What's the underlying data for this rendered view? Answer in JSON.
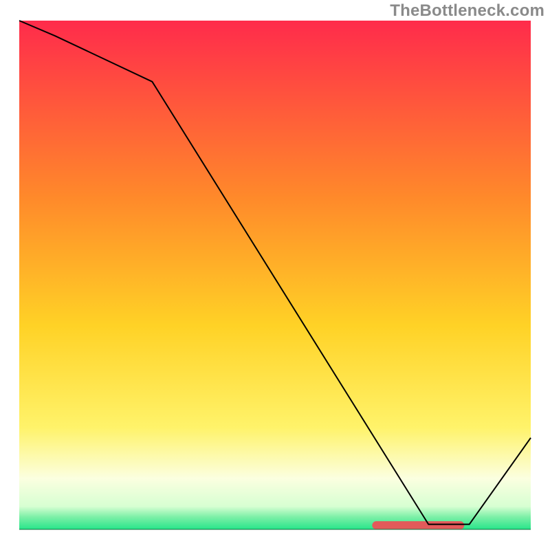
{
  "watermark": "TheBottleneck.com",
  "chart_data": {
    "type": "line",
    "title": "",
    "xlabel": "",
    "ylabel": "",
    "xlim": [
      0,
      100
    ],
    "ylim": [
      0,
      100
    ],
    "grid": false,
    "legend": false,
    "background_gradient_stops": [
      {
        "offset": 0,
        "color": "#ff2b4b"
      },
      {
        "offset": 0.35,
        "color": "#ff8a2a"
      },
      {
        "offset": 0.6,
        "color": "#ffd226"
      },
      {
        "offset": 0.8,
        "color": "#fff36a"
      },
      {
        "offset": 0.9,
        "color": "#fbffe0"
      },
      {
        "offset": 0.955,
        "color": "#d7ffd2"
      },
      {
        "offset": 0.975,
        "color": "#7ff0a8"
      },
      {
        "offset": 1.0,
        "color": "#27e58a"
      }
    ],
    "series": [
      {
        "name": "bottleneck-curve",
        "color": "#000000",
        "width": 2,
        "x": [
          0,
          7,
          26,
          80,
          88,
          100
        ],
        "values": [
          100,
          97,
          88,
          1,
          1,
          18
        ]
      }
    ],
    "marker": {
      "name": "optimal-range",
      "color": "#e25a5a",
      "x_start": 69,
      "x_end": 87,
      "y": 0.8,
      "thickness": 1.6
    }
  }
}
